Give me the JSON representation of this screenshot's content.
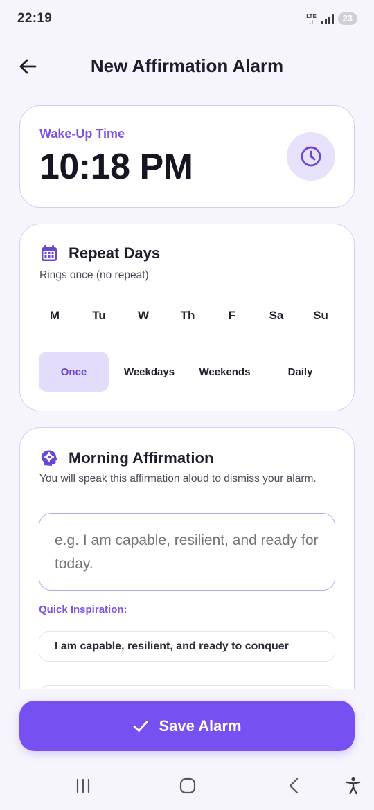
{
  "status_bar": {
    "time": "22:19",
    "network": "LTE",
    "battery": "23"
  },
  "header": {
    "title": "New Affirmation Alarm",
    "back_icon": "arrow-left-icon"
  },
  "wake_up": {
    "label": "Wake-Up Time",
    "time": "10:18 PM",
    "icon": "clock-icon"
  },
  "repeat": {
    "title": "Repeat Days",
    "subtitle": "Rings once (no repeat)",
    "icon": "calendar-icon",
    "days": [
      "M",
      "Tu",
      "W",
      "Th",
      "F",
      "Sa",
      "Su"
    ],
    "presets": [
      "Once",
      "Weekdays",
      "Weekends",
      "Daily"
    ],
    "selected_preset": "Once"
  },
  "affirmation": {
    "title": "Morning Affirmation",
    "icon": "head-gear-icon",
    "description": "You will speak this affirmation aloud to dismiss your alarm.",
    "input_placeholder": "e.g. I am capable, resilient, and ready for today.",
    "input_value": "",
    "quick_label": "Quick Inspiration:",
    "suggestions": [
      "I am capable, resilient, and ready to conquer",
      ""
    ]
  },
  "save_button": {
    "label": "Save Alarm",
    "icon": "check-icon"
  },
  "nav": {
    "recents": "recents-icon",
    "home": "home-icon",
    "back": "back-icon",
    "accessibility": "accessibility-icon"
  },
  "colors": {
    "accent": "#7650f0",
    "accent_light": "#e4dcfb",
    "background": "#f6f5fb",
    "card_border": "#d6ccf7"
  }
}
